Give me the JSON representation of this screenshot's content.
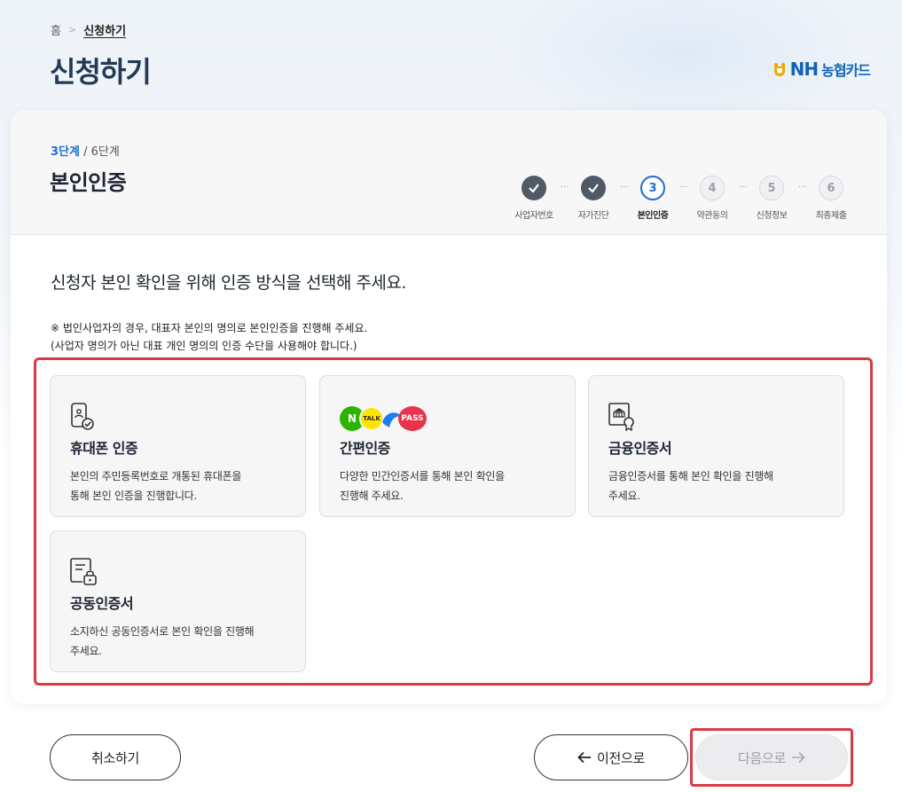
{
  "breadcrumb": {
    "home": "홈",
    "current": "신청하기"
  },
  "page_title": "신청하기",
  "logo": {
    "nh": "NH",
    "kr": "농협카드"
  },
  "step": {
    "current": "3단계",
    "sep": " / ",
    "total": "6단계",
    "title": "본인인증"
  },
  "stepper": [
    {
      "num": "",
      "label": "사업자번호",
      "state": "done"
    },
    {
      "num": "",
      "label": "자가진단",
      "state": "done"
    },
    {
      "num": "3",
      "label": "본인인증",
      "state": "active"
    },
    {
      "num": "4",
      "label": "약관동의",
      "state": "todo"
    },
    {
      "num": "5",
      "label": "신청정보",
      "state": "todo"
    },
    {
      "num": "6",
      "label": "최종제출",
      "state": "todo"
    }
  ],
  "dots": "···",
  "question": "신청자 본인 확인을 위해 인증 방식을 선택해 주세요.",
  "note": {
    "line1": "※ 법인사업자의 경우, 대표자 본인의 명의로 본인인증을 진행해 주세요.",
    "line2": "(사업자 명의가 아닌 대표 개인 명의의 인증 수단을 사용해야 합니다.)"
  },
  "methods": {
    "phone": {
      "icon": "phone-check-icon",
      "title": "휴대폰 인증",
      "desc1": "본인의 주민등록번호로 개통된 휴대폰을",
      "desc2": "통해 본인 인증을 진행합니다."
    },
    "easy": {
      "icon": "easy-auth-logos",
      "badges": {
        "naver": "N",
        "kakao": "TALK",
        "pass": "PASS"
      },
      "title": "간편인증",
      "desc1": "다양한 민간인증서를 통해 본인 확인을",
      "desc2": "진행해 주세요."
    },
    "financial": {
      "icon": "bank-certificate-icon",
      "title": "금융인증서",
      "desc1": "금융인증서를 통해 본인 확인을 진행해",
      "desc2": "주세요."
    },
    "joint": {
      "icon": "document-lock-icon",
      "title": "공동인증서",
      "desc1": "소지하신 공동인증서로 본인 확인을 진행해",
      "desc2": "주세요."
    }
  },
  "buttons": {
    "cancel": "취소하기",
    "prev": "이전으로",
    "next": "다음으로"
  },
  "colors": {
    "accent": "#1b6fd1",
    "title": "#233a55",
    "highlight": "#d93a44",
    "done": "#4f5a66"
  }
}
